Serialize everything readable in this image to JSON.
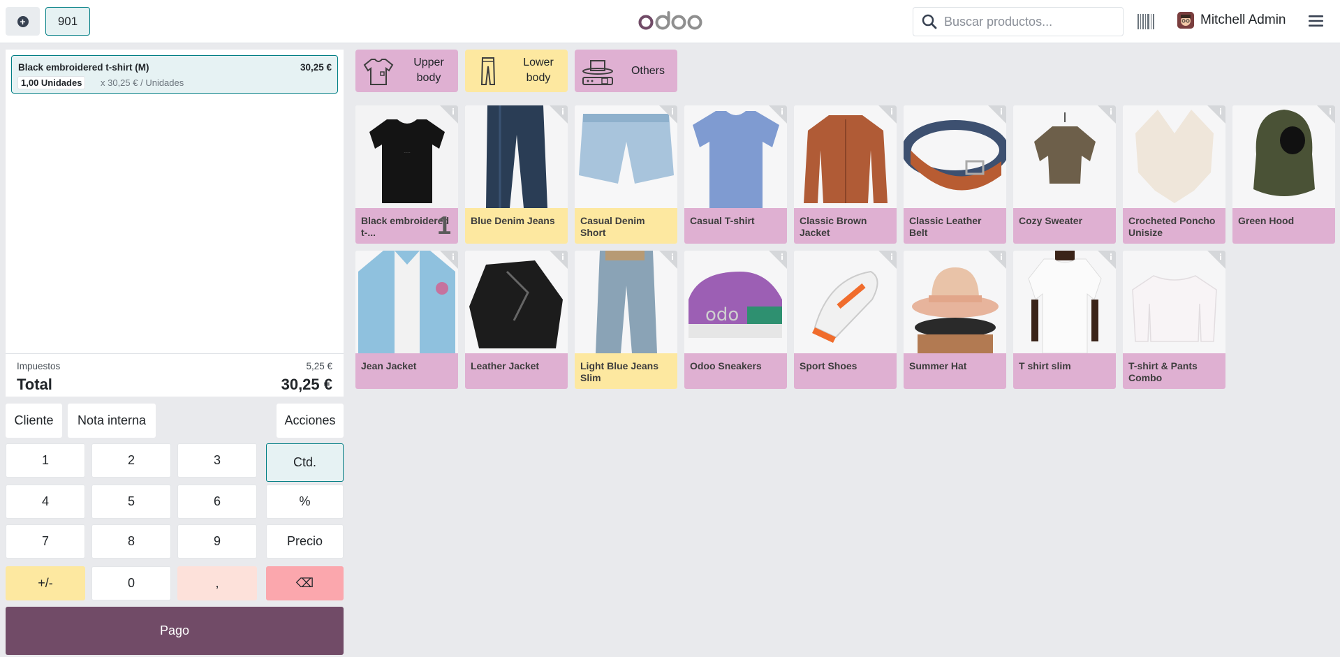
{
  "navbar": {
    "add_order_icon": "plus-circle-icon",
    "order_tab": "901",
    "logo_text": "odoo",
    "search_placeholder": "Buscar productos...",
    "user_name": "Mitchell Admin"
  },
  "order": {
    "line": {
      "name": "Black embroidered t-shirt (M)",
      "price": "30,25 €",
      "qty": "1,00 Unidades",
      "unit_price": "x 30,25 € / Unidades"
    },
    "tax_label": "Impuestos",
    "tax_value": "5,25 €",
    "total_label": "Total",
    "total_value": "30,25 €"
  },
  "actions": {
    "customer": "Cliente",
    "note": "Nota interna",
    "more": "Acciones"
  },
  "numpad": {
    "k1": "1",
    "k2": "2",
    "k3": "3",
    "qty": "Ctd.",
    "k4": "4",
    "k5": "5",
    "k6": "6",
    "disc": "%",
    "k7": "7",
    "k8": "8",
    "k9": "9",
    "price": "Precio",
    "sign": "+/-",
    "k0": "0",
    "comma": ",",
    "backspace": "⌫"
  },
  "pay_label": "Pago",
  "categories": [
    {
      "line1": "Upper",
      "line2": "body",
      "icon": "tshirt-icon"
    },
    {
      "line1": "Lower",
      "line2": "body",
      "icon": "trousers-icon"
    },
    {
      "line1": "Others",
      "line2": "",
      "icon": "hat-belt-icon"
    }
  ],
  "products": [
    {
      "name": "Black embroidered t-...",
      "qty": "1",
      "color": "pink"
    },
    {
      "name": "Blue Denim Jeans",
      "color": "yellow"
    },
    {
      "name": "Casual Denim Short",
      "color": "yellow"
    },
    {
      "name": "Casual T-shirt",
      "color": "pink"
    },
    {
      "name": "Classic Brown Jacket",
      "color": "pink"
    },
    {
      "name": "Classic Leather Belt",
      "color": "pink"
    },
    {
      "name": "Cozy Sweater",
      "color": "pink"
    },
    {
      "name": "Crocheted Poncho Unisize",
      "color": "pink"
    },
    {
      "name": "Green Hood",
      "color": "pink"
    },
    {
      "name": "Jean Jacket",
      "color": "pink"
    },
    {
      "name": "Leather Jacket",
      "color": "pink"
    },
    {
      "name": "Light Blue Jeans Slim",
      "color": "yellow"
    },
    {
      "name": "Odoo Sneakers",
      "color": "pink"
    },
    {
      "name": "Sport Shoes",
      "color": "pink"
    },
    {
      "name": "Summer Hat",
      "color": "pink"
    },
    {
      "name": "T shirt slim",
      "color": "pink"
    },
    {
      "name": "T-shirt & Pants Combo",
      "color": "pink"
    }
  ],
  "colors": {
    "brand": "#714b67",
    "accent": "#017e84",
    "pink": "#dfb0d2",
    "yellow": "#fde8a0"
  }
}
